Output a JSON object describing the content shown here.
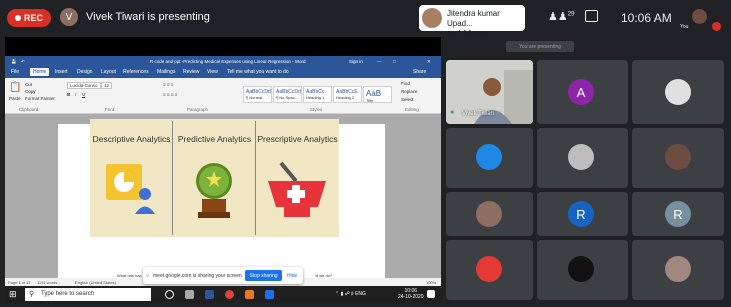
{
  "meet": {
    "rec_label": "REC",
    "presenter_initial": "V",
    "presenter_text": "Vivek Tiwari is presenting",
    "joiners_line1": "Jitendra kumar Upad...",
    "joiners_line2": "and 14 more",
    "people_count": "29",
    "time": "10:06 AM",
    "you_label": "You",
    "banner": "You are presenting"
  },
  "word": {
    "title": "R code and ppt -Predicting Medical Expenses using Linear Regression - Word",
    "sign_in": "Sign in",
    "tabs": [
      "File",
      "Home",
      "Insert",
      "Design",
      "Layout",
      "References",
      "Mailings",
      "Review",
      "View"
    ],
    "tell_me": "Tell me what you want to do",
    "share": "Share",
    "clipboard": {
      "paste": "Paste",
      "cut": "Cut",
      "copy": "Copy",
      "format_painter": "Format Painter",
      "group": "Clipboard"
    },
    "font": {
      "name": "Lucida Conso",
      "size": "12",
      "group": "Font"
    },
    "paragraph_group": "Paragraph",
    "styles": [
      {
        "sample": "AaBbCcDd",
        "name": "¶ Normal"
      },
      {
        "sample": "AaBbCcDd",
        "name": "¶ No Spac..."
      },
      {
        "sample": "AaBbCc",
        "name": "Heading 1"
      },
      {
        "sample": "AaBbCcE",
        "name": "Heading 2"
      },
      {
        "sample": "AaB",
        "name": "Title"
      }
    ],
    "styles_group": "Styles",
    "editing": {
      "find": "Find",
      "replace": "Replace",
      "select": "Select",
      "group": "Editing"
    },
    "slide_columns": [
      "Descriptive Analytics",
      "Predictive Analytics",
      "Prescriptive Analytics"
    ],
    "status": {
      "page": "Page 1 of 17",
      "words": "1191 words",
      "lang": "English (United States)",
      "zoom": "100%"
    },
    "partial_text_left": "What has hap",
    "partial_text_right": "ld we do?"
  },
  "share_bar": {
    "text": "meet.google.com is sharing your screen.",
    "stop": "Stop sharing",
    "hide": "Hide"
  },
  "taskbar": {
    "search_placeholder": "Type here to search",
    "tray_lang": "ENG",
    "clock_time": "10:06",
    "clock_date": "24-10-2020"
  },
  "participants": {
    "speaker_name": "Vivek Tiwari",
    "avatars": [
      {
        "initial": "A",
        "color": "#8e24aa"
      },
      {
        "initial": "R",
        "color": "#1565c0"
      },
      {
        "initial": "R",
        "color": "#78909c"
      }
    ]
  },
  "colors": {
    "rec": "#d93025",
    "word_blue": "#2b579a",
    "stop_blue": "#1a73e8"
  }
}
